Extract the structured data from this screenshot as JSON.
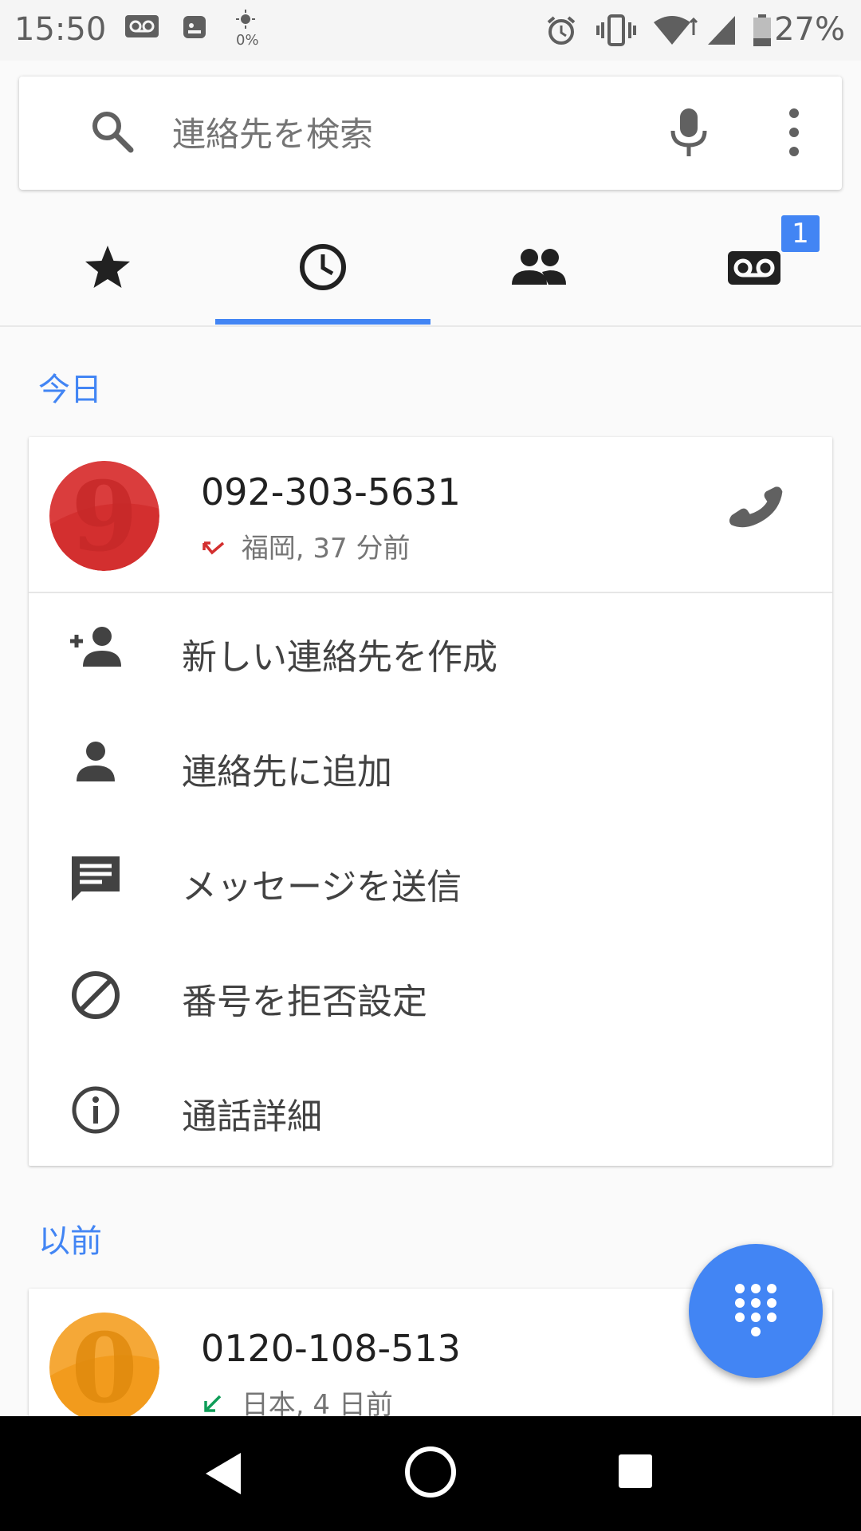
{
  "status_bar": {
    "time": "15:50",
    "nfc_percent": "0%",
    "battery_percent": "27%",
    "icons": [
      "voicemail-icon",
      "app-icon",
      "brightness-icon",
      "alarm-icon",
      "vibrate-icon",
      "wifi-icon",
      "signal-icon",
      "battery-icon"
    ]
  },
  "search": {
    "placeholder": "連絡先を検索"
  },
  "tabs": [
    {
      "name": "favorites",
      "icon": "star-icon"
    },
    {
      "name": "recents",
      "icon": "clock-icon",
      "selected": true
    },
    {
      "name": "contacts",
      "icon": "people-icon"
    },
    {
      "name": "voicemail",
      "icon": "voicemail-icon",
      "badge": "1"
    }
  ],
  "colors": {
    "accent": "#4285f4",
    "missed": "#d32f2f",
    "incoming": "#0f9d58"
  },
  "sections": {
    "today": "今日",
    "earlier": "以前"
  },
  "calls": [
    {
      "avatar_letter": "9",
      "avatar_color": "#d32f2f",
      "number": "092-303-5631",
      "location_time": "福岡, 37 分前",
      "call_type": "missed"
    },
    {
      "avatar_letter": "0",
      "avatar_color": "#f29b1d",
      "number": "0120-108-513",
      "location_time": "日本, 4 日前",
      "call_type": "incoming"
    }
  ],
  "actions": [
    {
      "label": "新しい連絡先を作成",
      "icon": "add-contact-icon"
    },
    {
      "label": "連絡先に追加",
      "icon": "person-icon"
    },
    {
      "label": "メッセージを送信",
      "icon": "message-icon"
    },
    {
      "label": "番号を拒否設定",
      "icon": "block-icon"
    },
    {
      "label": "通話詳細",
      "icon": "info-icon"
    }
  ]
}
